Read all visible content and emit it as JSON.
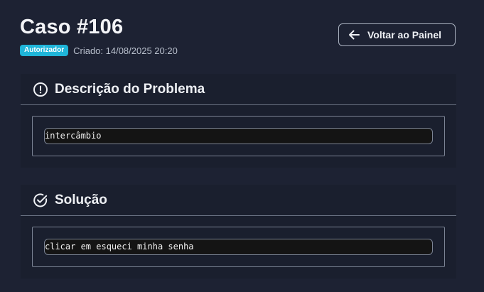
{
  "header": {
    "title": "Caso #106",
    "status_badge": "Autorizador",
    "created": "Criado: 14/08/2025 20:20",
    "back_button_label": "Voltar ao Painel",
    "back_icon": "arrow-left-icon"
  },
  "sections": {
    "problem": {
      "icon": "alert-circle-icon",
      "title": "Descrição do Problema",
      "value": "intercâmbio"
    },
    "solution": {
      "icon": "check-circle-icon",
      "title": "Solução",
      "value": "clicar em esqueci minha senha"
    }
  },
  "colors": {
    "background": "#1d2233",
    "badge": "#1fb5d9"
  }
}
